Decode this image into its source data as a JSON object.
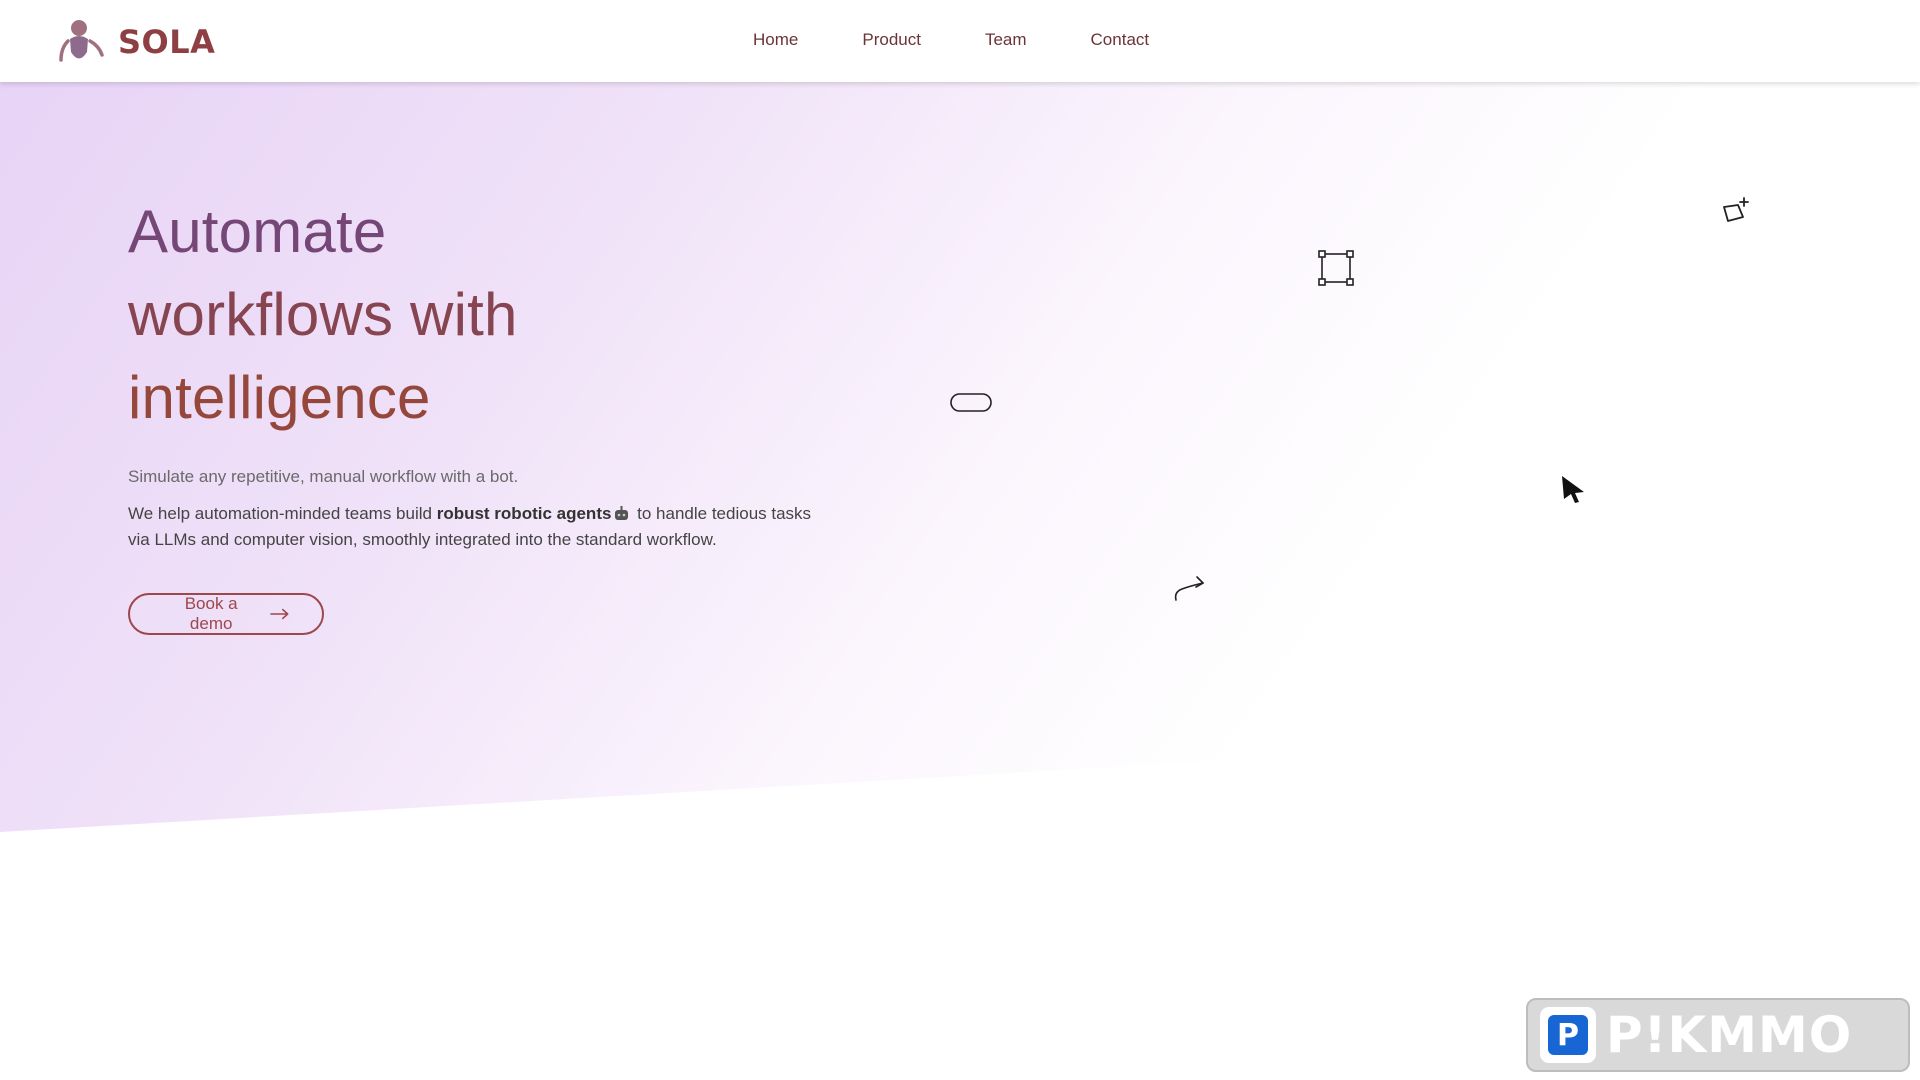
{
  "brand": {
    "name": "SOLA",
    "logo_icon": "robot-logo-icon"
  },
  "nav": {
    "items": [
      {
        "label": "Home"
      },
      {
        "label": "Product"
      },
      {
        "label": "Team"
      },
      {
        "label": "Contact"
      }
    ]
  },
  "hero": {
    "headline": [
      "Automate",
      "workflows with",
      "intelligence"
    ],
    "tagline": "Simulate any repetitive, manual workflow with a bot.",
    "desc_before": "We help automation-minded teams build ",
    "desc_bold": "robust robotic agents",
    "desc_after": " to handle tedious tasks via LLMs and computer vision, smoothly integrated into the standard workflow.",
    "cta_label": "Book a demo",
    "cta_icon": "arrow-right-icon",
    "colors": {
      "headline_line1": "#744776",
      "headline_line2": "#864550",
      "headline_line3": "#94473a",
      "cta": "#9e474c"
    }
  },
  "decorations": [
    "crop-frame-icon",
    "magic-tag-icon",
    "pill-outline-icon",
    "cursor-pointer-icon",
    "curved-arrow-icon"
  ],
  "watermark": {
    "letter": "P",
    "text": "P!KMMO"
  }
}
